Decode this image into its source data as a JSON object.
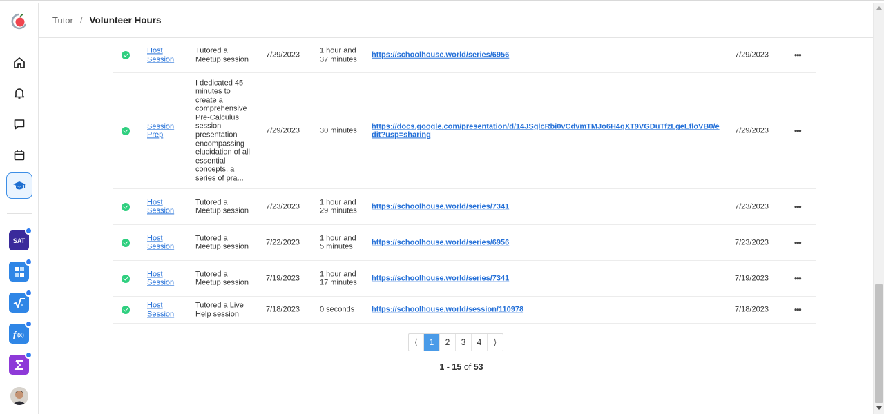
{
  "header": {
    "breadcrumb_root": "Tutor",
    "breadcrumb_sep": "/",
    "breadcrumb_current": "Volunteer Hours"
  },
  "sidebar": {
    "nav": [
      "home-icon",
      "bell-icon",
      "chat-icon",
      "calendar-icon",
      "graduation-cap-icon"
    ],
    "apps": [
      {
        "name": "SAT",
        "color": "#3a2a9b"
      },
      {
        "name": "calculator-icon",
        "color": "#2f86e6"
      },
      {
        "name": "square-root-icon",
        "color": "#2f86e6"
      },
      {
        "name": "function-icon",
        "color": "#2f86e6"
      },
      {
        "name": "sigma-icon",
        "color": "#8e3ad8"
      }
    ]
  },
  "rows": [
    {
      "type": "Host Session",
      "description": "Tutored a Meetup session",
      "date": "7/29/2023",
      "duration": "1 hour and 37 minutes",
      "link": "https://schoolhouse.world/series/6956",
      "logged": "7/29/2023",
      "more": "•••"
    },
    {
      "type": "Session Prep",
      "description": "I dedicated 45 minutes to create a comprehensive Pre-Calculus session presentation encompassing elucidation of all essential concepts, a series of pra...",
      "date": "7/29/2023",
      "duration": "30 minutes",
      "link": "https://docs.google.com/presentation/d/14JSglcRbi0vCdvmTMJo6H4qXT9VGDuTfzLgeLfloVB0/edit?usp=sharing",
      "logged": "7/29/2023",
      "more": "•••"
    },
    {
      "type": "Host Session",
      "description": "Tutored a Meetup session",
      "date": "7/23/2023",
      "duration": "1 hour and 29 minutes",
      "link": "https://schoolhouse.world/series/7341",
      "logged": "7/23/2023",
      "more": "•••"
    },
    {
      "type": "Host Session",
      "description": "Tutored a Meetup session",
      "date": "7/22/2023",
      "duration": "1 hour and 5 minutes",
      "link": "https://schoolhouse.world/series/6956",
      "logged": "7/23/2023",
      "more": "•••"
    },
    {
      "type": "Host Session",
      "description": "Tutored a Meetup session",
      "date": "7/19/2023",
      "duration": "1 hour and 17 minutes",
      "link": "https://schoolhouse.world/series/7341",
      "logged": "7/19/2023",
      "more": "•••"
    },
    {
      "type": "Host Session",
      "description": "Tutored a Live Help session",
      "date": "7/18/2023",
      "duration": "0 seconds",
      "link": "https://schoolhouse.world/session/110978",
      "logged": "7/18/2023",
      "more": "•••"
    }
  ],
  "pagination": {
    "prev": "⟨",
    "pages": [
      "1",
      "2",
      "3",
      "4"
    ],
    "next": "⟩",
    "current": "1",
    "range": "1 - 15",
    "of": "of",
    "total": "53"
  }
}
